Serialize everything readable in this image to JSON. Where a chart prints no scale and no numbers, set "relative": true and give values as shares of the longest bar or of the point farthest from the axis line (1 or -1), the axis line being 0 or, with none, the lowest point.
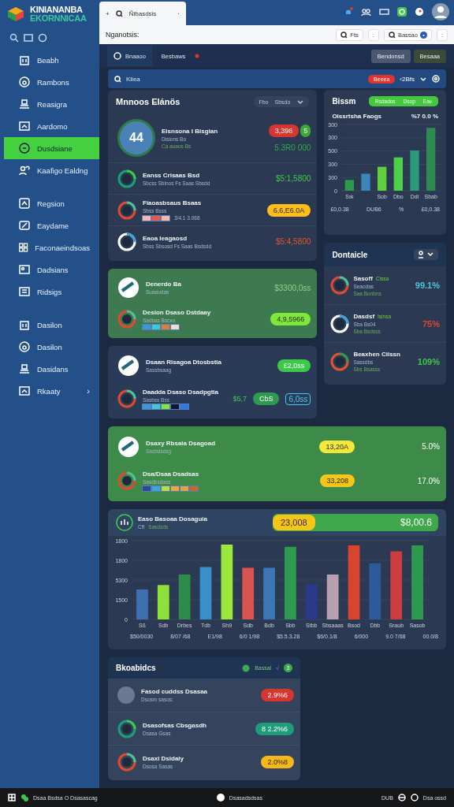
{
  "app": {
    "logo_top": "KINIANANBA",
    "logo_bottom": "EKORNNICAA"
  },
  "sidebar": {
    "sections": [
      {
        "items": [
          {
            "label": "Beabh",
            "selected": false
          },
          {
            "label": "Rambons",
            "selected": false
          },
          {
            "label": "Reasigra",
            "selected": false
          },
          {
            "label": "Aardomo",
            "selected": false
          },
          {
            "label": "Dusdsiane",
            "selected": true
          },
          {
            "label": "Kaafigo Ealdng",
            "selected": false
          }
        ]
      },
      {
        "items": [
          {
            "label": "Regsion",
            "selected": false
          },
          {
            "label": "Eaydame",
            "selected": false
          },
          {
            "label": "Faconaeindsoas",
            "selected": false
          },
          {
            "label": "Dadsians",
            "selected": false
          },
          {
            "label": "Ridsigs",
            "selected": false
          }
        ]
      },
      {
        "items": [
          {
            "label": "Dasilon",
            "selected": false
          },
          {
            "label": "Dasilon",
            "selected": false
          },
          {
            "label": "Dasidans",
            "selected": false
          },
          {
            "label": "Rkaaty",
            "selected": false,
            "arrow": "›"
          }
        ]
      }
    ]
  },
  "browser": {
    "tab_plus": "+",
    "tab_title": "Ñibasdsis",
    "tab_close": "·",
    "address": "Nganotsis:",
    "address_button": "Fts",
    "address_more": ":",
    "search_label": "Bassao",
    "search_count": "•",
    "menu": ":"
  },
  "tabs": [
    {
      "label": "Bnaaoo",
      "selected": true
    },
    {
      "label": "Besbaws",
      "selected": false
    }
  ],
  "tab_buttons": [
    {
      "label": "Bendonsd",
      "color": "#4a5870"
    },
    {
      "label": "Besaaa",
      "color": "#3c4a38"
    }
  ],
  "search": {
    "placeholder": "Kliea",
    "badge": "Beeea",
    "count": "‹2Bfs"
  },
  "accounts": {
    "title": "Mnnoos Elánös",
    "filter": [
      "Fbo",
      "Sbsdo"
    ],
    "rows": [
      {
        "avatar": "44",
        "title": "Eisnsona I Bisgian",
        "subtitle": "Disions Bo",
        "note": "Ca auaos Bs",
        "value": "5.3R0 000",
        "color": "#2fa84a",
        "badge": "3,396",
        "tag": "5"
      },
      {
        "title": "Eanss Crisaas Bsd",
        "subtitle": "Sbcss Sbinos Fs Saas Sbsdd",
        "value": "$5:1,5800",
        "color": "#3ec84a",
        "kind": "text"
      },
      {
        "title": "Fiaoasbsaus Bsaas",
        "subtitle": "Sbss Bsss",
        "swatches": [
          {
            "color": "#f2b8b0"
          },
          {
            "color": "#e85a50"
          },
          {
            "color": "#f2b8b0"
          }
        ],
        "meta": "3/4.1  3.068",
        "value": "6,6,E6.0A",
        "color": "#ffbe1a",
        "kind": "badge"
      },
      {
        "title": "Eaoa Ieagaosd",
        "subtitle": "Sbss Sbsosd Fs Saas Bsdsdd",
        "value": "$5:4,5800",
        "color": "#e0552f",
        "kind": "text"
      }
    ]
  },
  "growth": {
    "title": "Bissm",
    "pills": [
      "Rsdados",
      "Dsop",
      "Eav"
    ],
    "subtitle": "Oissrtsha Faogs",
    "reading": "%7 0.0 %",
    "chart_data": {
      "type": "bar",
      "relative": true,
      "categories": [
        "Sık",
        null,
        "Sob",
        "Dbo",
        "Ddi",
        "Sbab"
      ],
      "series": [
        {
          "values": [
            0.17,
            0.27,
            0.38,
            0.53,
            0.64,
            1
          ]
        }
      ]
    },
    "y_axis_labels": [
      "300",
      "300",
      "500",
      "300",
      "300",
      "0"
    ],
    "footer": [
      "£0,0.38",
      "DUB6",
      "%",
      "£0,0.38"
    ]
  },
  "highlight": {
    "rows": [
      {
        "title": "Denerdo Ba",
        "subtitle": "Suaaudas",
        "value": "$3300,0ss",
        "color": "#8fd08a",
        "kind": "text"
      },
      {
        "title": "Desion Dsaso Dstdaay",
        "subtitle": "Sadsas Bscxo",
        "swatches": [
          {
            "color": "#3a9ad8"
          },
          {
            "color": "#3ec8d8"
          },
          {
            "color": "#d8803a"
          },
          {
            "color": "#e8e0d8"
          }
        ],
        "value": "4,9,5966",
        "color": "#7ee83a",
        "kind": "badge"
      }
    ]
  },
  "domains": {
    "title": "Dontaicle",
    "rows": [
      {
        "title": "Sasoff",
        "tag": "Cissa",
        "subtitle": "Seaodas",
        "note": "Saa Bonbns",
        "value": "99.1%",
        "color": "#4ac8d8"
      },
      {
        "title": "Dasdsf",
        "tag": "Isinsa",
        "subtitle": "Sba Bs04",
        "note": "Sba Bsdsss",
        "value": "75%",
        "color": "#e0452f"
      },
      {
        "title": "Beaxhen Ciissn",
        "subtitle": "Sassdbs",
        "note": "Sbs Bsasss",
        "value": "109%",
        "color": "#3ec84a"
      }
    ]
  },
  "projects": {
    "rows": [
      {
        "title": "Dsaan Risagoa Dtosbstia",
        "subtitle": "Sassbsaag",
        "value": "£2,0ss",
        "color": "#3ec84a",
        "kind": "badge"
      },
      {
        "title": "Daadda Dsaso Dsadpgtia",
        "subtitle": "Sasbss Bss",
        "swatches": [
          {
            "color": "#3a9ad8"
          },
          {
            "color": "#3ec8d8"
          },
          {
            "color": "#7ee83a"
          },
          {
            "color": "#101830"
          },
          {
            "color": "#2a7ae8"
          }
        ],
        "amount": "$5,7",
        "value": "CbS",
        "color": "#2e9a50",
        "kind": "badge",
        "extra": "6,0ss"
      }
    ]
  },
  "totals": {
    "rows": [
      {
        "title": "Dsaxy Rbsaia Dsagoad",
        "subtitle": "Sasbdsdsg",
        "value": "13,20A",
        "color": "#f5e83a",
        "kind": "badge",
        "extra": "5.0%"
      },
      {
        "title": "Dsa/Dsaa Dsadsas",
        "subtitle": "Sasdbsdass",
        "swatches": [
          {
            "color": "#2a4a9a"
          },
          {
            "color": "#3aa8d8"
          },
          {
            "color": "#b8e03a"
          },
          {
            "color": "#e8a83a"
          },
          {
            "color": "#d8a83a"
          },
          {
            "color": "#c8682a"
          }
        ],
        "value": "33,208",
        "color": "#f5c518",
        "kind": "badge",
        "extra": "17.0%"
      }
    ]
  },
  "revenue": {
    "title": "Easo Basoaa Dosaguia",
    "subtitle": "Cft",
    "note": "Sasdsds",
    "badge": "23,008",
    "total": "$8,00.6",
    "chart_data": {
      "type": "bar",
      "relative": true,
      "categories": [
        "Sß",
        "Sdb",
        "Drbes",
        "Tdb",
        "Sh9",
        "Sdb",
        "Bdb",
        "Sbb",
        "Stbb",
        "Sbsaaas",
        "Bsod",
        "Dbb",
        "Sraub",
        "Sasob"
      ],
      "series": [
        {
          "values": [
            0.4,
            0.46,
            0.6,
            0.7,
            1,
            0.69,
            0.69,
            0.97,
            0.47,
            0.6,
            0.99,
            0.75,
            0.91,
            0.99
          ]
        }
      ]
    },
    "y_axis_labels": [
      "1800",
      "1800",
      "5300",
      "1500",
      "0"
    ],
    "footer": [
      "$50/0030",
      "8/07 /68",
      "E1/98",
      "6/0 1/98",
      "$5.5.3.28",
      "$6/0.1/8",
      "6/000",
      "9.0 7/68",
      "00.0/8"
    ]
  },
  "activity": {
    "title": "Bkoabidcs",
    "filter": "Bassal",
    "check": "√",
    "count": "3",
    "rows": [
      {
        "title": "Fasod cuddss Dsasaa",
        "subtitle": "Dsosm sasos:",
        "value": "2.9%6",
        "color": "#d9342f",
        "kind": "badge"
      },
      {
        "title": "Dsasofsas Cbsgasdh",
        "subtitle": "Dsasa Gsas",
        "value": "8 2.2%6",
        "color": "#1f9c7a",
        "kind": "badge"
      },
      {
        "title": "Dsaxi Dsidaiy",
        "subtitle": "Dsosa Sasas",
        "value": "2.0%8",
        "color": "#f5b818",
        "kind": "badge"
      }
    ]
  },
  "taskbar": {
    "left": "Dsaa Bsdsa O Dsasascag",
    "center": "Dsasadsdsas",
    "clock": "DUB",
    "right": "Dsa ossd"
  }
}
